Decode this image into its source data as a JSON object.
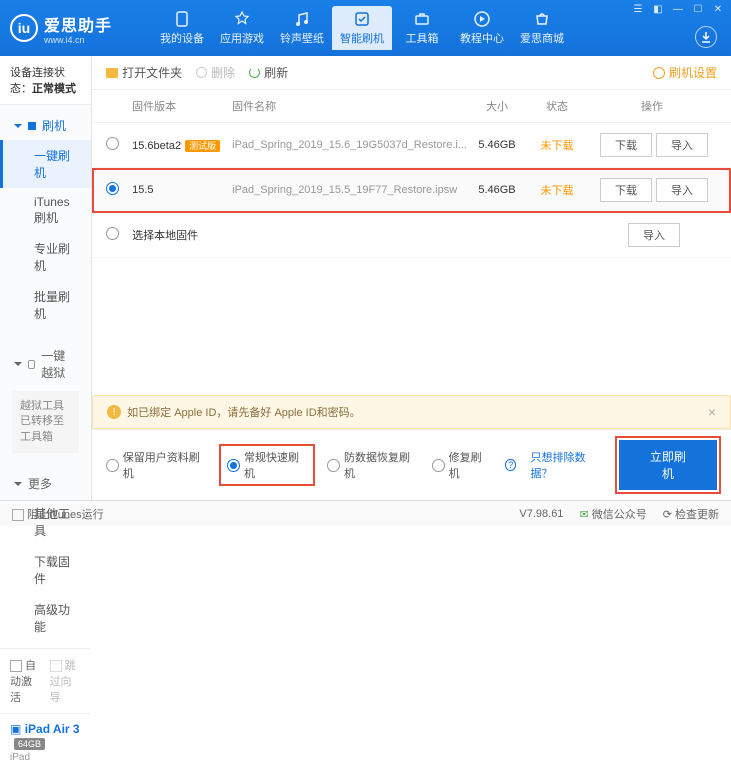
{
  "header": {
    "app_name": "爱思助手",
    "url": "www.i4.cn",
    "nav": [
      "我的设备",
      "应用游戏",
      "铃声壁纸",
      "智能刷机",
      "工具箱",
      "教程中心",
      "爱思商城"
    ],
    "active_nav": 3
  },
  "sidebar": {
    "conn_label": "设备连接状态：",
    "conn_value": "正常模式",
    "sec_flash": "刷机",
    "flash_items": [
      "一键刷机",
      "iTunes刷机",
      "专业刷机",
      "批量刷机"
    ],
    "sec_jailbreak": "一键越狱",
    "jailbreak_note": "越狱工具已转移至工具箱",
    "sec_more": "更多",
    "more_items": [
      "其他工具",
      "下载固件",
      "高级功能"
    ],
    "auto_activate": "自动激活",
    "skip_guide": "跳过向导",
    "device_name": "iPad Air 3",
    "device_storage": "64GB",
    "device_type": "iPad"
  },
  "toolbar": {
    "open_folder": "打开文件夹",
    "delete": "删除",
    "refresh": "刷新",
    "settings": "刷机设置"
  },
  "table": {
    "h_version": "固件版本",
    "h_name": "固件名称",
    "h_size": "大小",
    "h_status": "状态",
    "h_ops": "操作",
    "rows": [
      {
        "ver": "15.6beta2",
        "beta": "测试版",
        "name": "iPad_Spring_2019_15.6_19G5037d_Restore.i...",
        "size": "5.46GB",
        "status": "未下载",
        "selected": false
      },
      {
        "ver": "15.5",
        "beta": "",
        "name": "iPad_Spring_2019_15.5_19F77_Restore.ipsw",
        "size": "5.46GB",
        "status": "未下载",
        "selected": true
      }
    ],
    "local_fw": "选择本地固件",
    "btn_download": "下载",
    "btn_import": "导入"
  },
  "footer": {
    "warn_text": "如已绑定 Apple ID，请先备好 Apple ID和密码。",
    "mode_keep": "保留用户资料刷机",
    "mode_normal": "常规快速刷机",
    "mode_recover": "防数据恢复刷机",
    "mode_repair": "修复刷机",
    "exclude_link": "只想排除数据？",
    "flash_now": "立即刷机"
  },
  "statusbar": {
    "block_itunes": "阻止iTunes运行",
    "version": "V7.98.61",
    "wechat": "微信公众号",
    "check_update": "检查更新"
  }
}
